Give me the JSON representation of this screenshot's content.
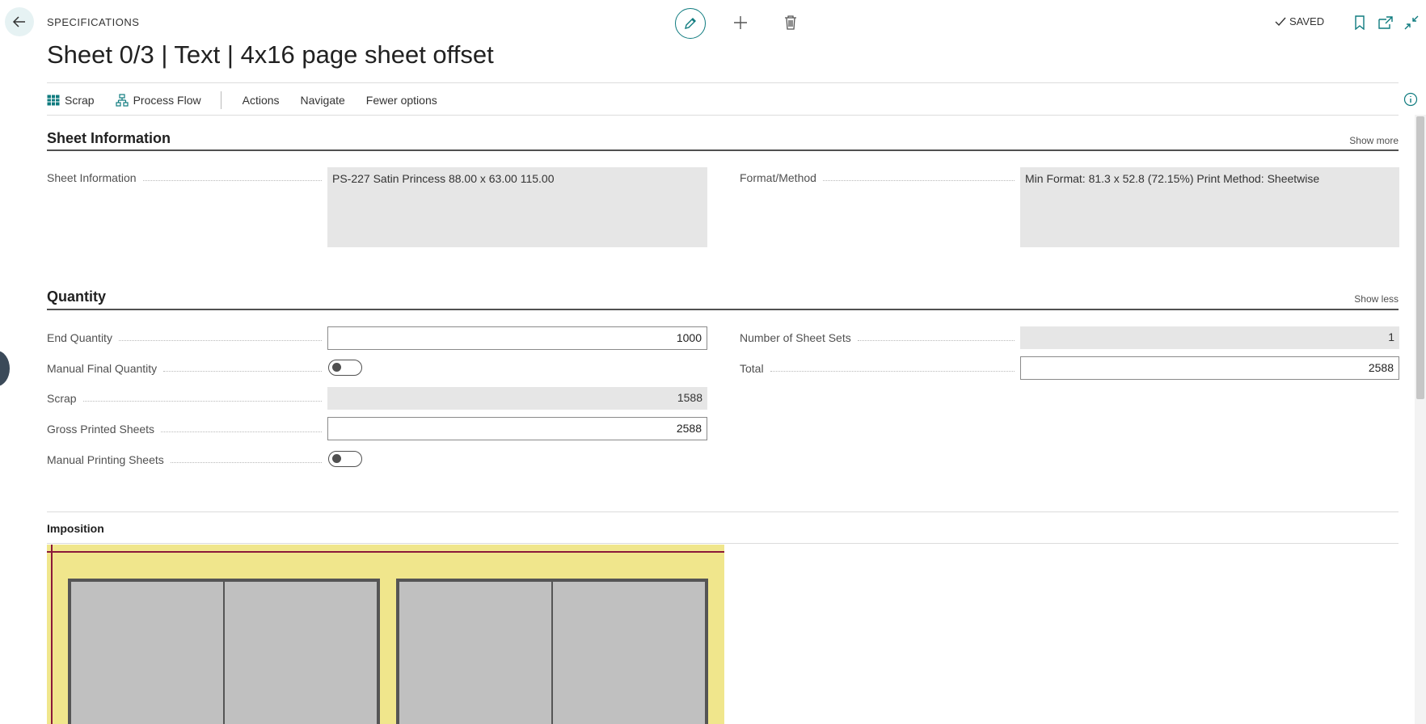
{
  "header": {
    "caption": "SPECIFICATIONS",
    "title": "Sheet 0/3 | Text | 4x16 page sheet offset",
    "status": "SAVED"
  },
  "actions": {
    "scrap": "Scrap",
    "process_flow": "Process Flow",
    "actions": "Actions",
    "navigate": "Navigate",
    "fewer_options": "Fewer options"
  },
  "sheet_information": {
    "title": "Sheet Information",
    "show_link": "Show more",
    "fields": {
      "sheet_info_label": "Sheet Information",
      "sheet_info_value": "PS-227 Satin Princess 88.00 x 63.00   115.00",
      "format_label": "Format/Method",
      "format_value": "Min Format: 81.3 x 52.8 (72.15%) Print Method: Sheetwise"
    }
  },
  "quantity": {
    "title": "Quantity",
    "show_link": "Show less",
    "end_quantity_label": "End Quantity",
    "end_quantity_value": "1000",
    "manual_final_quantity_label": "Manual Final Quantity",
    "scrap_label": "Scrap",
    "scrap_value": "1588",
    "gross_printed_label": "Gross Printed Sheets",
    "gross_printed_value": "2588",
    "manual_printing_label": "Manual Printing Sheets",
    "sheet_sets_label": "Number of Sheet Sets",
    "sheet_sets_value": "1",
    "total_label": "Total",
    "total_value": "2588"
  },
  "imposition": {
    "title": "Imposition"
  },
  "colors": {
    "accent": "#0f7b7f",
    "imposition_bg": "#f0e68c",
    "register_line": "#8b1a3a",
    "page_fill": "#c0c0c0"
  }
}
